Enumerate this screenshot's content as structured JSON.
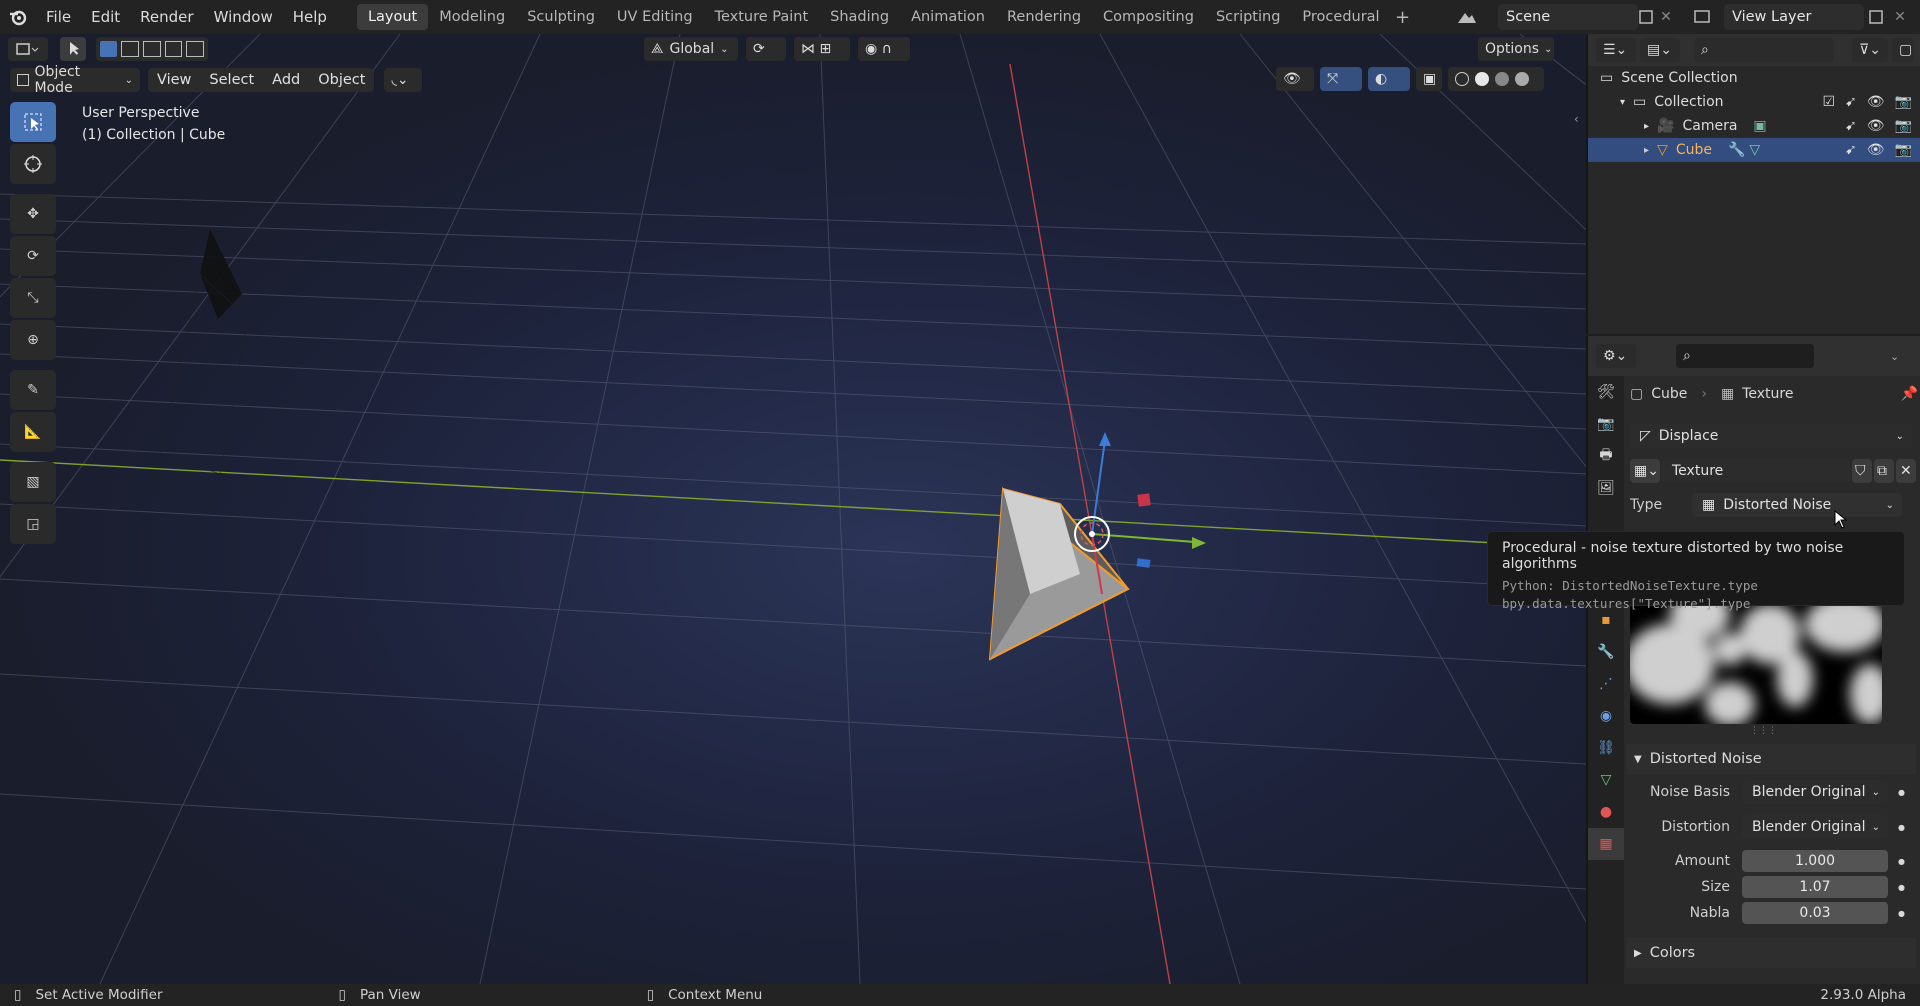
{
  "topbar": {
    "menus": [
      "File",
      "Edit",
      "Render",
      "Window",
      "Help"
    ],
    "workspaces": [
      "Layout",
      "Modeling",
      "Sculpting",
      "UV Editing",
      "Texture Paint",
      "Shading",
      "Animation",
      "Rendering",
      "Compositing",
      "Scripting",
      "Procedural"
    ],
    "active_workspace": "Layout",
    "scene": "Scene",
    "view_layer": "View Layer"
  },
  "viewport": {
    "transform_orientation": "Global",
    "options_label": "Options",
    "mode": "Object Mode",
    "menus": [
      "View",
      "Select",
      "Add",
      "Object"
    ],
    "overlay_title": "User Perspective",
    "overlay_subtitle": "(1) Collection | Cube"
  },
  "outliner": {
    "root": "Scene Collection",
    "collection": "Collection",
    "items": [
      {
        "name": "Camera",
        "selected": false
      },
      {
        "name": "Cube",
        "selected": true
      }
    ]
  },
  "properties": {
    "breadcrumb_object": "Cube",
    "breadcrumb_texture": "Texture",
    "modifier": "Displace",
    "texture_name": "Texture",
    "type_label": "Type",
    "type_value": "Distorted Noise",
    "panel_title": "Distorted Noise",
    "noise_basis_label": "Noise Basis",
    "noise_basis_value": "Blender Original",
    "distortion_label": "Distortion",
    "distortion_value": "Blender Original",
    "amount_label": "Amount",
    "amount_value": "1.000",
    "size_label": "Size",
    "size_value": "1.07",
    "nabla_label": "Nabla",
    "nabla_value": "0.03",
    "colors_label": "Colors"
  },
  "tooltip": {
    "title": "Procedural - noise texture distorted by two noise algorithms",
    "python1": "Python: DistortedNoiseTexture.type",
    "python2": "bpy.data.textures[\"Texture\"].type"
  },
  "statusbar": {
    "left": "Set Active Modifier",
    "middle": "Pan View",
    "right": "Context Menu",
    "version": "2.93.0 Alpha"
  },
  "colors": {
    "accent": "#4772b3",
    "selected_text": "#f6b45a",
    "x_axis": "#d04040",
    "y_axis": "#8ab735"
  }
}
